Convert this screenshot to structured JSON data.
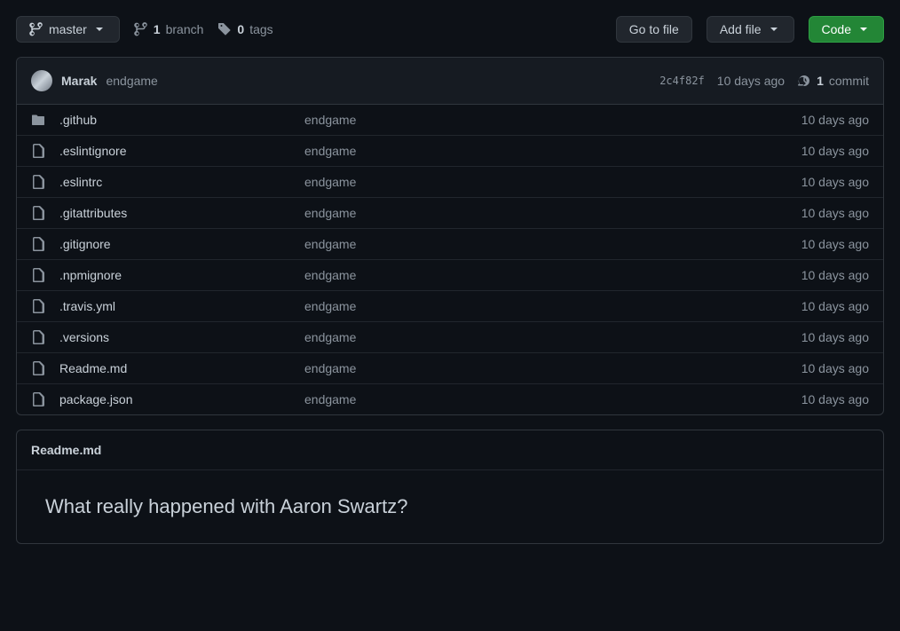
{
  "toolbar": {
    "branch": "master",
    "branch_count": "1",
    "branch_label": "branch",
    "tag_count": "0",
    "tag_label": "tags",
    "go_to_file": "Go to file",
    "add_file": "Add file",
    "code": "Code"
  },
  "commit": {
    "author": "Marak",
    "message": "endgame",
    "sha": "2c4f82f",
    "age": "10 days ago",
    "count": "1",
    "count_label": "commit"
  },
  "files": [
    {
      "type": "dir",
      "name": ".github",
      "msg": "endgame",
      "age": "10 days ago"
    },
    {
      "type": "file",
      "name": ".eslintignore",
      "msg": "endgame",
      "age": "10 days ago"
    },
    {
      "type": "file",
      "name": ".eslintrc",
      "msg": "endgame",
      "age": "10 days ago"
    },
    {
      "type": "file",
      "name": ".gitattributes",
      "msg": "endgame",
      "age": "10 days ago"
    },
    {
      "type": "file",
      "name": ".gitignore",
      "msg": "endgame",
      "age": "10 days ago"
    },
    {
      "type": "file",
      "name": ".npmignore",
      "msg": "endgame",
      "age": "10 days ago"
    },
    {
      "type": "file",
      "name": ".travis.yml",
      "msg": "endgame",
      "age": "10 days ago"
    },
    {
      "type": "file",
      "name": ".versions",
      "msg": "endgame",
      "age": "10 days ago"
    },
    {
      "type": "file",
      "name": "Readme.md",
      "msg": "endgame",
      "age": "10 days ago"
    },
    {
      "type": "file",
      "name": "package.json",
      "msg": "endgame",
      "age": "10 days ago"
    }
  ],
  "readme": {
    "filename": "Readme.md",
    "heading": "What really happened with Aaron Swartz?"
  }
}
